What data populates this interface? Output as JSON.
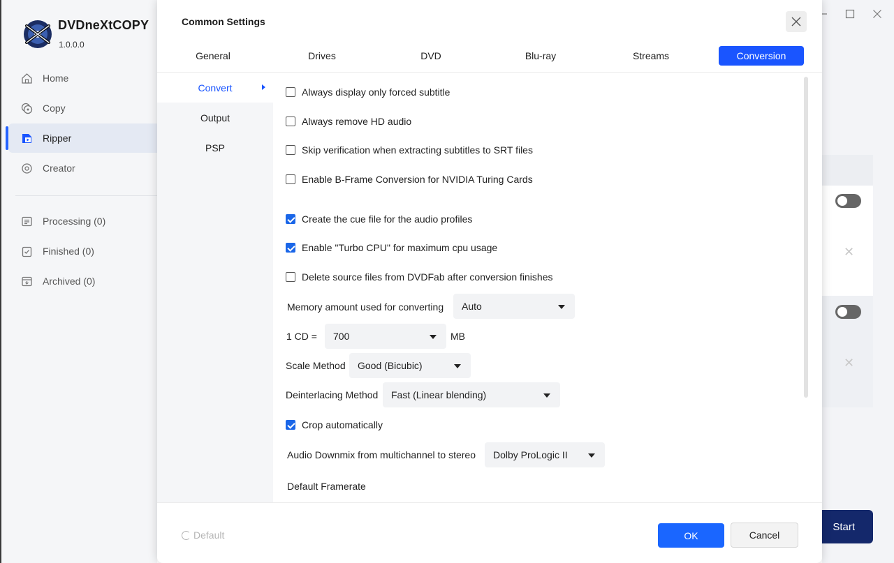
{
  "app": {
    "name": "DVDneXtCOPY",
    "version": "1.0.0.0",
    "nav": [
      {
        "label": "Home",
        "icon": "home-icon"
      },
      {
        "label": "Copy",
        "icon": "copy-icon"
      },
      {
        "label": "Ripper",
        "icon": "ripper-icon",
        "active": true
      },
      {
        "label": "Creator",
        "icon": "creator-icon"
      }
    ],
    "queue": [
      {
        "label": "Processing (0)",
        "icon": "processing-icon"
      },
      {
        "label": "Finished (0)",
        "icon": "finished-icon"
      },
      {
        "label": "Archived (0)",
        "icon": "archived-icon"
      }
    ],
    "start_label": "Start",
    "accent_color": "#1a55ff"
  },
  "dialog": {
    "title": "Common Settings",
    "tabs": [
      {
        "label": "General"
      },
      {
        "label": "Drives"
      },
      {
        "label": "DVD"
      },
      {
        "label": "Blu-ray"
      },
      {
        "label": "Streams"
      },
      {
        "label": "Conversion",
        "active": true
      }
    ],
    "subnav": [
      {
        "label": "Convert",
        "active": true
      },
      {
        "label": "Output"
      },
      {
        "label": "PSP"
      }
    ],
    "options": [
      {
        "label": "Always display only forced subtitle",
        "checked": false
      },
      {
        "label": "Always remove HD audio",
        "checked": false
      },
      {
        "label": "Skip verification when extracting subtitles to SRT files",
        "checked": false
      },
      {
        "label": "Enable B-Frame Conversion for NVIDIA Turing Cards",
        "checked": false
      },
      {
        "label": "Create the cue file for the audio profiles",
        "checked": true
      },
      {
        "label": "Enable \"Turbo CPU\" for maximum cpu usage",
        "checked": true
      },
      {
        "label": "Delete source files from DVDFab after conversion finishes",
        "checked": false
      }
    ],
    "memory": {
      "label": "Memory amount used for converting",
      "value": "Auto"
    },
    "cd_size": {
      "label": "1 CD =",
      "value": "700",
      "unit": "MB"
    },
    "scale": {
      "label": "Scale Method",
      "value": "Good (Bicubic)"
    },
    "deinterlace": {
      "label": "Deinterlacing Method",
      "value": "Fast (Linear blending)"
    },
    "crop": {
      "label": "Crop automatically",
      "checked": true
    },
    "downmix": {
      "label": "Audio Downmix from multichannel to stereo",
      "value": "Dolby ProLogic II"
    },
    "framerate": {
      "label": "Default Framerate"
    },
    "footer": {
      "default_label": "Default",
      "ok_label": "OK",
      "cancel_label": "Cancel"
    }
  }
}
